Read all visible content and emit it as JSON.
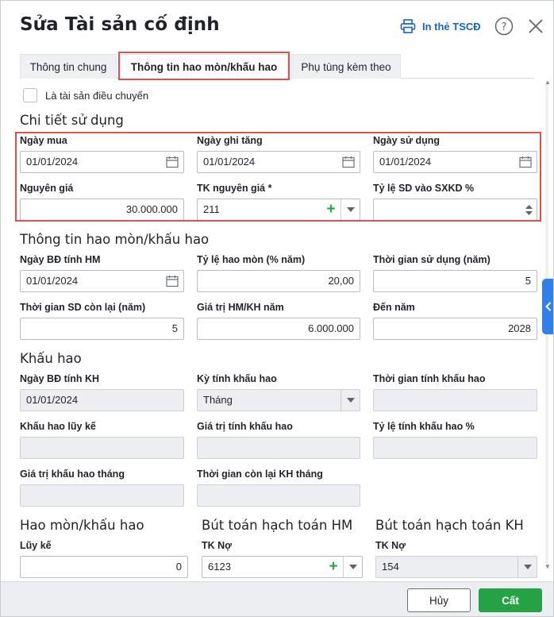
{
  "dialog": {
    "title": "Sửa Tài sản cố định",
    "print_label": "In thẻ TSCĐ"
  },
  "tabs": [
    {
      "label": "Thông tin chung"
    },
    {
      "label": "Thông tin hao mòn/khấu hao"
    },
    {
      "label": "Phụ tùng kèm theo"
    }
  ],
  "transfer_checkbox": {
    "label": "Là tài sản điều chuyển",
    "checked": false
  },
  "usage": {
    "title": "Chi tiết sử dụng",
    "purchase_date": {
      "label": "Ngày mua",
      "value": "01/01/2024"
    },
    "record_date": {
      "label": "Ngày ghi tăng",
      "value": "01/01/2024"
    },
    "use_date": {
      "label": "Ngày sử dụng",
      "value": "01/01/2024"
    },
    "cost": {
      "label": "Nguyên giá",
      "value": "30.000.000"
    },
    "cost_account": {
      "label": "TK nguyên giá *",
      "value": "211"
    },
    "business_ratio": {
      "label": "Tỷ lệ SD vào SXKD %",
      "value": ""
    }
  },
  "depreciation_info": {
    "title": "Thông tin hao mòn/khấu hao",
    "start_hm_date": {
      "label": "Ngày BĐ tính HM",
      "value": "01/01/2024"
    },
    "rate": {
      "label": "Tỷ lệ hao mòn (% năm)",
      "value": "20,00"
    },
    "useful_life": {
      "label": "Thời gian sử dụng (năm)",
      "value": "5"
    },
    "remaining_life": {
      "label": "Thời gian SD còn lại (năm)",
      "value": "5"
    },
    "annual_value": {
      "label": "Giá trị HM/KH năm",
      "value": "6.000.000"
    },
    "end_year": {
      "label": "Đến năm",
      "value": "2028"
    }
  },
  "amortization": {
    "title": "Khấu hao",
    "start_kh_date": {
      "label": "Ngày BĐ tính KH",
      "value": "01/01/2024"
    },
    "period": {
      "label": "Kỳ tính khấu hao",
      "value": "Tháng"
    },
    "kh_time": {
      "label": "Thời gian tính khấu hao",
      "value": ""
    },
    "accumulated": {
      "label": "Khấu hao lũy kế",
      "value": ""
    },
    "kh_value": {
      "label": "Giá trị tính khấu hao",
      "value": ""
    },
    "kh_rate": {
      "label": "Tỷ lệ tính khấu hao %",
      "value": ""
    },
    "monthly_value": {
      "label": "Giá trị khấu hao tháng",
      "value": ""
    },
    "remaining_months": {
      "label": "Thời gian còn lại KH tháng",
      "value": ""
    }
  },
  "entries": {
    "hm_title": "Hao mòn/khấu hao",
    "hm_entry_title": "Bút toán hạch toán HM",
    "kh_entry_title": "Bút toán hạch toán KH",
    "cumulative": {
      "label": "Lũy kế",
      "value": "0"
    },
    "hm_debit": {
      "label": "TK Nợ",
      "value": "6123"
    },
    "kh_debit": {
      "label": "TK Nợ",
      "value": "154"
    }
  },
  "footer": {
    "cancel_label": "Hủy",
    "save_label": "Cất"
  },
  "colors": {
    "accent": "#1565c0",
    "save": "#25a244",
    "highlight": "#e2504c",
    "handle": "#2f80ed"
  }
}
